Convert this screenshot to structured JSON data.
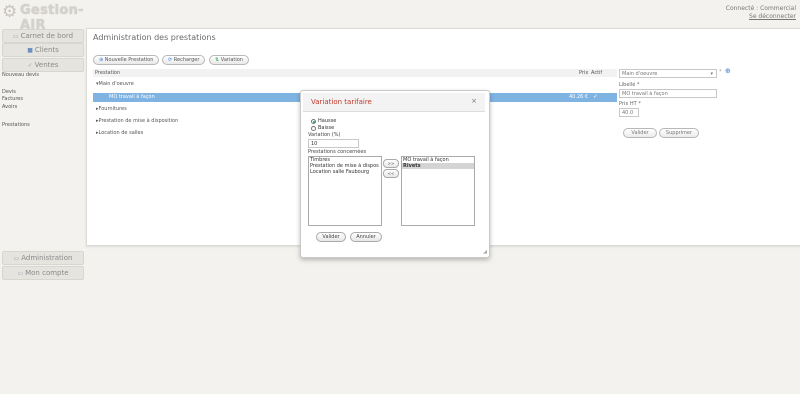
{
  "app": {
    "logo_text": "Gestion-AIR",
    "logo_icon": "gear-icon"
  },
  "user": {
    "connected": "Connecté : Commercial",
    "logout": "Se déconnecter"
  },
  "nav": {
    "dashboard": "Carnet de bord",
    "clients": "Clients",
    "sales": "Ventes",
    "sales_links": [
      "Nouveau devis",
      "Devis",
      "Factures",
      "Avoirs",
      "Prestations"
    ],
    "administration": "Administration",
    "account": "Mon compte"
  },
  "main": {
    "title": "Administration des prestations",
    "toolbar": {
      "new": "Nouvelle Prestation",
      "reload": "Recharger",
      "variation": "Variation"
    },
    "columns": {
      "name": "Prestation",
      "price": "Prix",
      "active": "Actif"
    },
    "tree": {
      "group1": "Main d'oeuvre",
      "selected": {
        "label": "MO travail à façon",
        "price": "40.26 €"
      },
      "group2": "Fournitures",
      "group3": "Prestation de mise à disposition",
      "group4": "Location de salles"
    },
    "form": {
      "category_value": "Main d'oeuvre",
      "label_label": "Libellé *",
      "label_value": "MO travail à façon",
      "price_label": "Prix HT *",
      "price_value": "40.0",
      "validate": "Valider",
      "delete": "Supprimer"
    }
  },
  "modal": {
    "title": "Variation tarifaire",
    "close": "×",
    "raise": "Hausse",
    "lower": "Baisse",
    "variation_label": "Variation (%)",
    "variation_value": "10",
    "concerned_label": "Prestations concernées",
    "available": [
      "Timbres",
      "Prestation de mise à dispos",
      "Location salle Faubourg"
    ],
    "selected": [
      "MO travail à façon",
      "Rivets"
    ],
    "add": ">>",
    "remove": "<<",
    "validate": "Valider",
    "cancel": "Annuler"
  },
  "colors": {
    "accent": "#7fb3e2",
    "title_red": "#c0392b",
    "bg": "#f3f2ee"
  }
}
